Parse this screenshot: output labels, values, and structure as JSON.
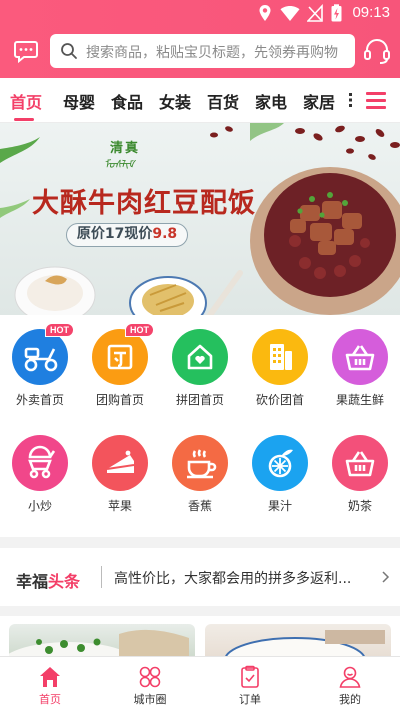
{
  "status_bar": {
    "time": "09:13"
  },
  "search": {
    "placeholder": "搜索商品，粘贴宝贝标题，先领券再购物"
  },
  "tabs": [
    {
      "label": "首页",
      "active": true
    },
    {
      "label": "母婴"
    },
    {
      "label": "食品"
    },
    {
      "label": "女装"
    },
    {
      "label": "百货"
    },
    {
      "label": "家电"
    },
    {
      "label": "家居"
    }
  ],
  "banner": {
    "tag": "清真",
    "tag_script": "ᠮᠤᠰᠯᠢᠮ",
    "title": "大酥牛肉红豆配饭",
    "price_prefix": "原价17现价",
    "price_now": "9.8"
  },
  "grid": [
    {
      "label": "外卖首页",
      "badge": "HOT",
      "color": "#1f7fe0",
      "icon": "scooter-icon"
    },
    {
      "label": "团购首页",
      "badge": "HOT",
      "color": "#fb9c12",
      "icon": "group-buy-icon"
    },
    {
      "label": "拼团首页",
      "color": "#25c05e",
      "icon": "home-heart-icon"
    },
    {
      "label": "砍价团首",
      "color": "#fbb90f",
      "icon": "building-icon"
    },
    {
      "label": "果蔬生鲜",
      "color": "#d55ddb",
      "icon": "basket-icon"
    },
    {
      "label": "小炒",
      "color": "#f1478a",
      "icon": "stroller-icon"
    },
    {
      "label": "苹果",
      "color": "#f3545c",
      "icon": "cake-icon"
    },
    {
      "label": "香蕉",
      "color": "#f46a44",
      "icon": "coffee-icon"
    },
    {
      "label": "果汁",
      "color": "#1ba3f0",
      "icon": "orange-icon"
    },
    {
      "label": "奶茶",
      "color": "#f3507a",
      "icon": "basket-icon"
    }
  ],
  "news": {
    "brand_a": "幸福",
    "brand_b": "头条",
    "text": "高性价比，大家都会用的拼多多返利..."
  },
  "bottom_nav": [
    {
      "label": "首页",
      "active": true,
      "icon": "home-icon"
    },
    {
      "label": "城市圈",
      "icon": "grid-circles-icon"
    },
    {
      "label": "订单",
      "icon": "clipboard-icon"
    },
    {
      "label": "我的",
      "icon": "user-icon"
    }
  ],
  "colors": {
    "brand": "#f33f68",
    "header": "#fb5a7d"
  }
}
